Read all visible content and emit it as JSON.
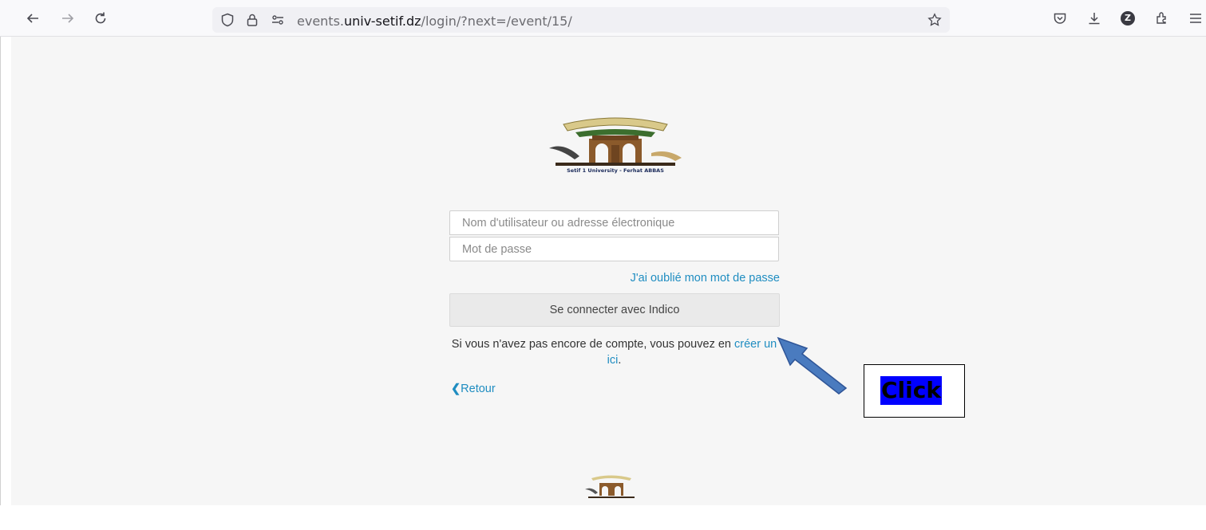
{
  "browser": {
    "url_prefix": "events.",
    "url_domain": "univ-setif.dz",
    "url_path": "/login/?next=/event/15/",
    "profile_letter": "Z"
  },
  "page": {
    "logo_caption": "Setif 1 University - Ferhat ABBAS",
    "username_placeholder": "Nom d'utilisateur ou adresse électronique",
    "password_placeholder": "Mot de passe",
    "forgot_link": "J'ai oublié mon mot de passe",
    "login_button": "Se connecter avec Indico",
    "register_text": "Si vous n'avez pas encore de compte, vous pouvez en ",
    "register_link": "créer un ici",
    "register_end": ".",
    "back_link": "Retour",
    "link_color": "#1f8dc1"
  },
  "annotation": {
    "label": "Click",
    "arrow_color": "#4a7bbf",
    "label_bg": "#0000ff"
  }
}
